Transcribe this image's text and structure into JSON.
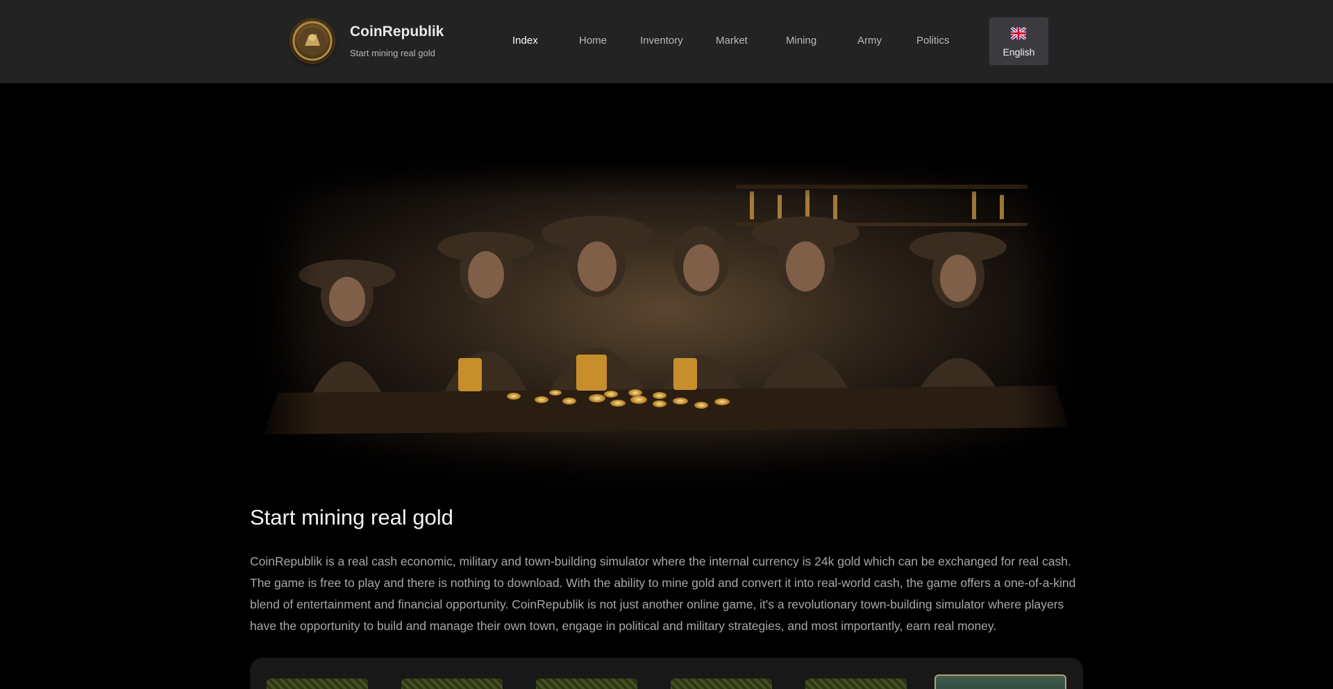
{
  "header": {
    "brand_title": "CoinRepublik",
    "brand_subtitle": "Start mining real gold",
    "nav": [
      {
        "label": "Index",
        "active": true
      },
      {
        "label": "Home",
        "active": false
      },
      {
        "label": "Inventory",
        "active": false
      },
      {
        "label": "Market",
        "active": false
      },
      {
        "label": "Mining",
        "active": false
      },
      {
        "label": "Army",
        "active": false
      },
      {
        "label": "Politics",
        "active": false
      }
    ],
    "language": {
      "label": "English",
      "icon": "uk-flag-icon"
    }
  },
  "hero": {
    "image": "saloon-gold-coins-illustration"
  },
  "main": {
    "headline": "Start mining real gold",
    "intro": "CoinRepublik is a real cash economic, military and town-building simulator where the internal currency is 24k gold which can be exchanged for real cash. The game is free to play and there is nothing to download. With the ability to mine gold and convert it into real-world cash, the game offers a one-of-a-kind blend of entertainment and financial opportunity. CoinRepublik is not just another online game, it's a revolutionary town-building simulator where players have the opportunity to build and manage their own town, engage in political and military strategies, and most importantly, earn real money."
  },
  "colors": {
    "header_bg": "#232323",
    "page_bg": "#000000",
    "nav_text": "#b9b9b9",
    "nav_active": "#ffffff",
    "lang_button_bg": "#3b3b3f",
    "body_text": "#a8a8a8"
  }
}
